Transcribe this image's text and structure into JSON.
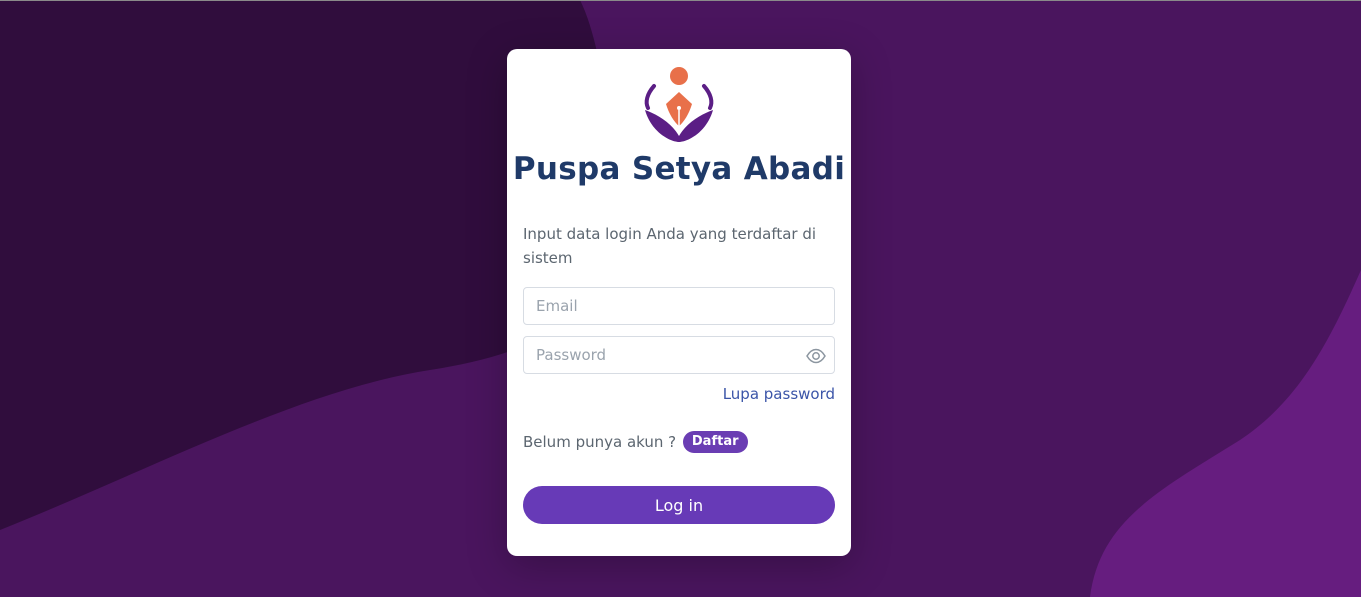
{
  "colors": {
    "background": "#4a155e",
    "background_dark": "#300d3d",
    "background_light": "#661d7f",
    "card": "#ffffff",
    "title": "#1f3a68",
    "accent": "#673ab7",
    "logo_orange": "#e8704a",
    "logo_purple": "#5b1e85"
  },
  "brand": {
    "logo_icon": "lotus-pen-logo-icon",
    "title": "Puspa Setya Abadi"
  },
  "login": {
    "intro": "Input data login Anda yang terdaftar di sistem",
    "email_placeholder": "Email",
    "password_placeholder": "Password",
    "password_toggle_icon": "eye-icon",
    "forgot_password": "Lupa password",
    "no_account_text": "Belum punya akun ?",
    "register_label": "Daftar",
    "submit_label": "Log in"
  }
}
